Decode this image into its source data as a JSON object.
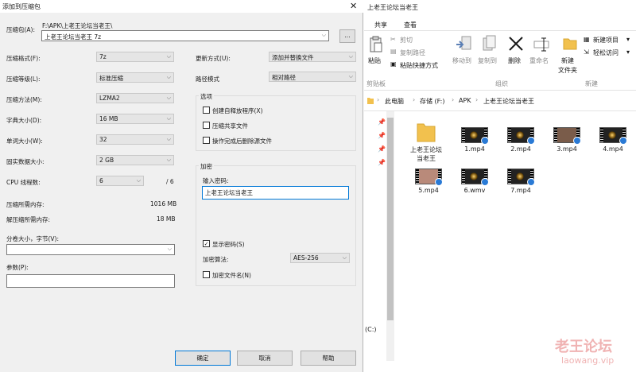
{
  "dialog": {
    "title": "添加到压缩包",
    "archive_label": "压缩包(A):",
    "archive_path": "F:\\APK\\上老王论坛当老王\\",
    "archive_name": "上老王论坛当老王 7z",
    "browse_label": "...",
    "left": [
      {
        "label": "压缩格式(F):",
        "value": "7z"
      },
      {
        "label": "压缩等级(L):",
        "value": "标准压缩"
      },
      {
        "label": "压缩方法(M):",
        "value": "LZMA2"
      },
      {
        "label": "字典大小(D):",
        "value": "16 MB"
      },
      {
        "label": "单词大小(W):",
        "value": "32"
      },
      {
        "label": "固实数据大小:",
        "value": "2 GB"
      }
    ],
    "cpu_label": "CPU 线程数:",
    "cpu_value": "6",
    "cpu_total": "/ 6",
    "mem_compress_label": "压缩所需内存:",
    "mem_compress_value": "1016 MB",
    "mem_decompress_label": "解压缩所需内存:",
    "mem_decompress_value": "18 MB",
    "split_label": "分卷大小，字节(V):",
    "split_value": "",
    "params_label": "参数(P):",
    "params_value": "",
    "update_label": "更新方式(U):",
    "update_value": "添加并替换文件",
    "path_label": "路径模式",
    "path_value": "相对路径",
    "options_title": "选项",
    "opt_sfx": "创建自释放程序(X)",
    "opt_shared": "压缩共享文件",
    "opt_delete": "操作完成后删除源文件",
    "enc_title": "加密",
    "enc_pw_label": "输入密码:",
    "enc_pw_value": "上老王论坛当老王",
    "show_pw": "显示密码(S)",
    "enc_method_label": "加密算法:",
    "enc_method_value": "AES-256",
    "enc_names": "加密文件名(N)",
    "ok": "确定",
    "cancel": "取消",
    "help": "帮助"
  },
  "explorer": {
    "window_title": "上老王论坛当老王",
    "tabs": [
      "共享",
      "查看"
    ],
    "ribbon": {
      "paste": "粘贴",
      "cut": "剪切",
      "copy_path": "复制路径",
      "paste_shortcut": "粘贴快捷方式",
      "move_to": "移动到",
      "copy_to": "复制到",
      "delete": "删除",
      "rename": "重命名",
      "new_folder_1": "新建",
      "new_folder_2": "文件夹",
      "new_item": "新建项目",
      "easy_access": "轻松访问",
      "group_clipboard": "剪贴板",
      "group_organize": "组织",
      "group_new": "新建"
    },
    "breadcrumb": [
      "此电脑",
      "存储 (F:)",
      "APK",
      "上老王论坛当老王"
    ],
    "files": [
      {
        "name": "上老王论坛当老王",
        "type": "folder"
      },
      {
        "name": "1.mp4",
        "type": "video"
      },
      {
        "name": "2.mp4",
        "type": "video"
      },
      {
        "name": "3.mp4",
        "type": "video"
      },
      {
        "name": "4.mp4",
        "type": "video"
      },
      {
        "name": "5.mp4",
        "type": "video"
      },
      {
        "name": "6.wmv",
        "type": "video"
      },
      {
        "name": "7.mp4",
        "type": "video"
      }
    ],
    "drive_label": "(C:)"
  },
  "watermark": {
    "line1": "老王论坛",
    "line2": "laowang.vip"
  }
}
